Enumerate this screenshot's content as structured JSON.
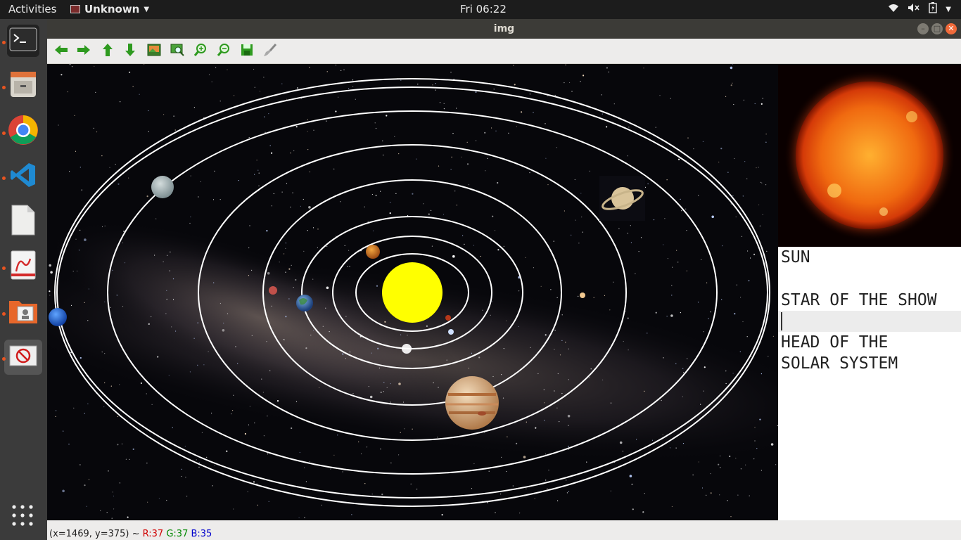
{
  "topbar": {
    "activities": "Activities",
    "app_name": "Unknown",
    "app_menu_icon": "caret-down-icon",
    "clock": "Fri 06:22",
    "tray_icons": [
      "wifi-icon",
      "volume-muted-icon",
      "battery-icon",
      "power-menu-icon"
    ]
  },
  "dock": {
    "items": [
      {
        "name": "terminal",
        "icon": "terminal-icon",
        "running": true
      },
      {
        "name": "file-manager",
        "icon": "file-cabinet-icon",
        "running": true
      },
      {
        "name": "chrome",
        "icon": "chrome-icon",
        "running": true
      },
      {
        "name": "vscode",
        "icon": "vscode-icon",
        "running": true
      },
      {
        "name": "text-editor",
        "icon": "document-icon",
        "running": false
      },
      {
        "name": "document-viewer",
        "icon": "pdf-viewer-icon",
        "running": true
      },
      {
        "name": "image-viewer",
        "icon": "image-folder-icon",
        "running": true
      },
      {
        "name": "blocked-app",
        "icon": "no-entry-icon",
        "running": true
      }
    ],
    "show_apps_icon": "grid-icon"
  },
  "window": {
    "title": "img",
    "buttons": [
      "minimize-icon",
      "maximize-icon",
      "close-icon"
    ]
  },
  "toolbar": {
    "buttons": [
      {
        "name": "pan-left",
        "icon": "arrow-left-icon"
      },
      {
        "name": "pan-right",
        "icon": "arrow-right-icon"
      },
      {
        "name": "pan-up",
        "icon": "arrow-up-icon"
      },
      {
        "name": "pan-down",
        "icon": "arrow-down-icon"
      },
      {
        "name": "zoom-fit",
        "icon": "image-icon"
      },
      {
        "name": "zoom-actual",
        "icon": "zoom-region-icon"
      },
      {
        "name": "zoom-in",
        "icon": "zoom-in-icon"
      },
      {
        "name": "zoom-out",
        "icon": "zoom-out-icon"
      },
      {
        "name": "save",
        "icon": "save-icon"
      },
      {
        "name": "properties",
        "icon": "brush-icon"
      }
    ]
  },
  "side_panel": {
    "lines": [
      "SUN",
      "",
      "STAR OF THE SHOW",
      "",
      "HEAD OF THE",
      "SOLAR SYSTEM"
    ]
  },
  "status": {
    "coords": "(x=1469, y=375) ~ ",
    "r": "R:37",
    "g": "G:37",
    "b": "B:35"
  },
  "colors": {
    "topbar_bg": "#1c1c1c",
    "dock_bg": "#3b3b3b",
    "titlebar_bg": "#3c3b37",
    "toolbar_icon_green": "#2e9a1f",
    "sun_center": "#ffff00",
    "orbit_stroke": "#ffffff",
    "close_button": "#f06a3a"
  }
}
